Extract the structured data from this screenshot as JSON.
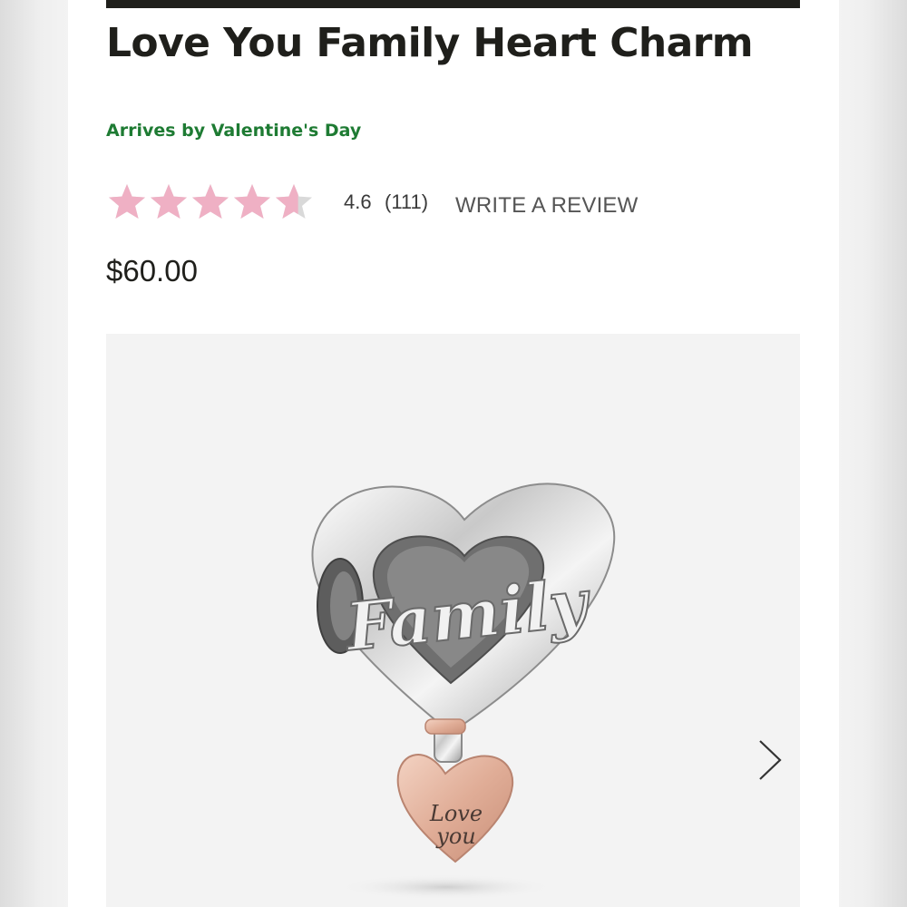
{
  "product": {
    "title": "Love You Family Heart Charm",
    "arrival": "Arrives by Valentine's Day",
    "price": "$60.00"
  },
  "rating": {
    "value": "4.6",
    "count": "(111)",
    "stars_filled": 4.6,
    "stars_total": 5,
    "write_review_label": "WRITE A REVIEW"
  },
  "gallery": {
    "charm_engraving": "Family",
    "pendant_engraving_line1": "Love",
    "pendant_engraving_line2": "you",
    "next_icon": "chevron-right-icon"
  },
  "colors": {
    "star": "#efb0c4",
    "star_empty": "#d9d9d9",
    "arrival_green": "#1e7b33",
    "title": "#1f1f1b"
  }
}
